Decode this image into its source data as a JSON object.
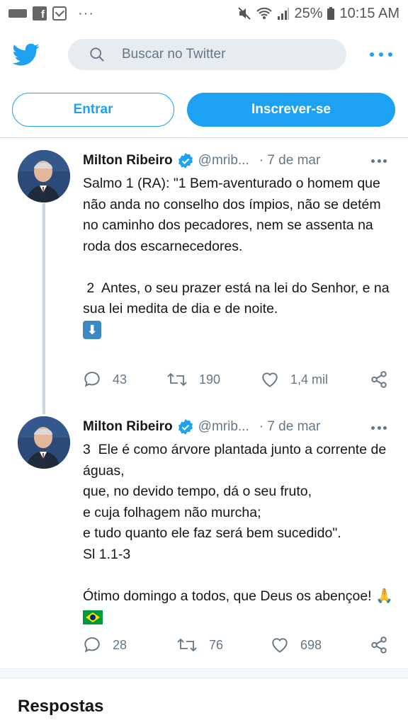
{
  "status_bar": {
    "battery": "25%",
    "time": "10:15 AM",
    "dots": "···",
    "fb_glyph": "f"
  },
  "header": {
    "search_placeholder": "Buscar no Twitter"
  },
  "auth": {
    "login_label": "Entrar",
    "signup_label": "Inscrever-se"
  },
  "tweets": [
    {
      "author": "Milton Ribeiro",
      "handle": "@mrib...",
      "date": "· 7 de mar",
      "text": "Salmo 1 (RA): \"1 Bem-aventurado o homem que não anda no conselho dos ímpios, não se detém no caminho dos pecadores, nem se assenta na roda dos escarnecedores.\n\n 2  Antes, o seu prazer está na lei do Senhor, e na sua lei medita de dia e de noite.",
      "emoji": "⬇",
      "replies": "43",
      "retweets": "190",
      "likes": "1,4 mil"
    },
    {
      "author": "Milton Ribeiro",
      "handle": "@mrib...",
      "date": "· 7 de mar",
      "text": "3  Ele é como árvore plantada junto a corrente de águas,\nque, no devido tempo, dá o seu fruto,\ne cuja folhagem não murcha;\ne tudo quanto ele faz será bem sucedido\".\nSl 1.1-3\n\nÓtimo domingo a todos, que Deus os abençoe! ",
      "emoji": "🙏",
      "replies": "28",
      "retweets": "76",
      "likes": "698"
    }
  ],
  "replies_section": {
    "title": "Respostas"
  },
  "colors": {
    "accent": "#1da1f2",
    "muted": "#657786",
    "text": "#14171a"
  }
}
